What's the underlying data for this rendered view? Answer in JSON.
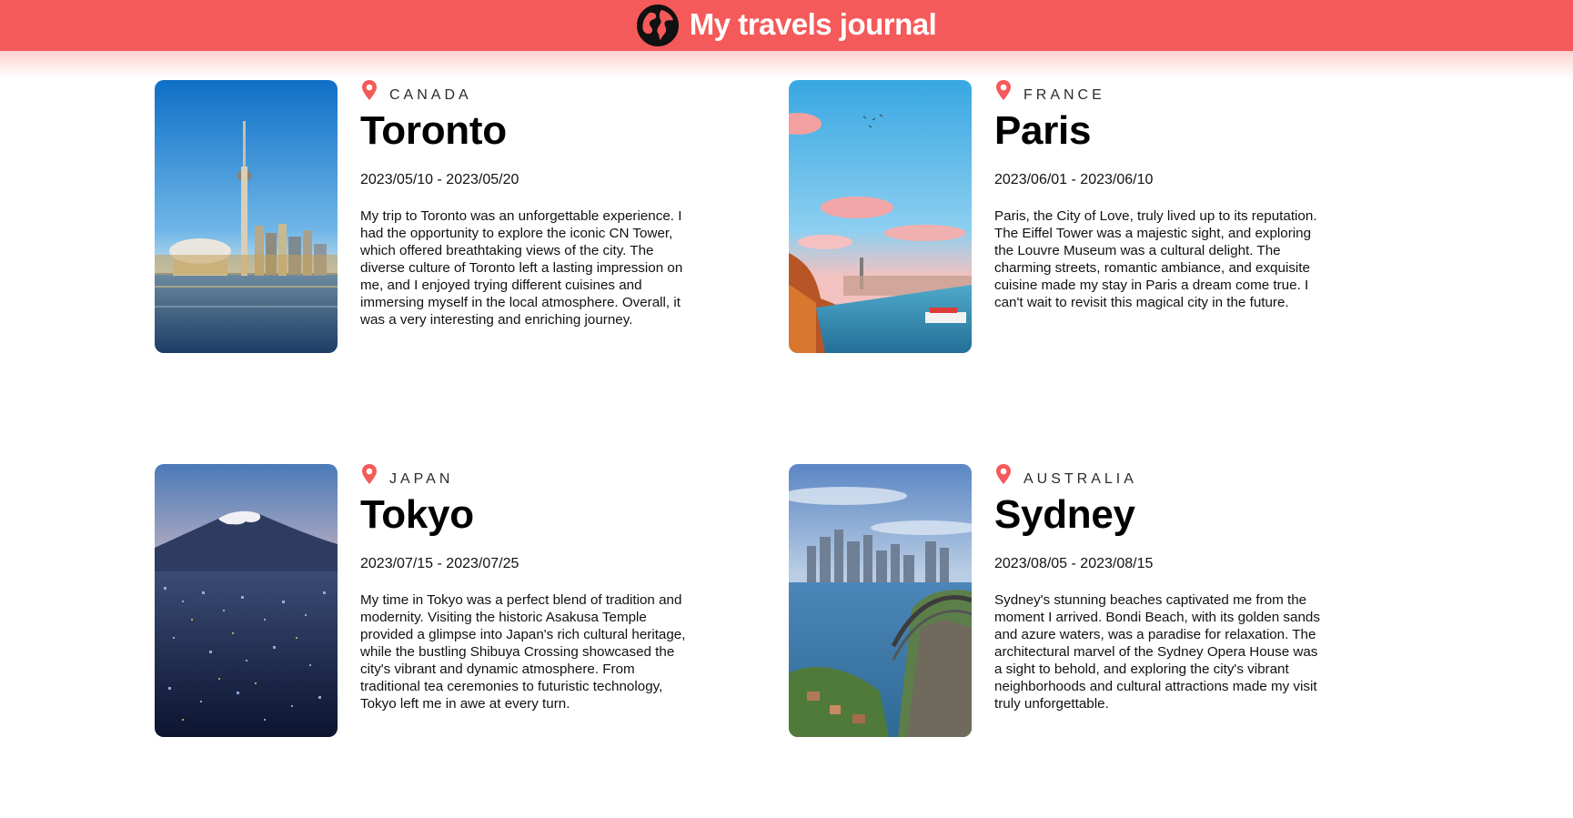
{
  "header": {
    "title": "My travels journal",
    "icon": "globe-icon",
    "background": "#f55a5a"
  },
  "entries": [
    {
      "country": "CANADA",
      "city": "Toronto",
      "dates": "2023/05/10 - 2023/05/20",
      "description": "My trip to Toronto was an unforgettable experience. I had the opportunity to explore the iconic CN Tower, which offered breathtaking views of the city. The diverse culture of Toronto left a lasting impression on me, and I enjoyed trying different cuisines and immersing myself in the local atmosphere. Overall, it was a very interesting and enriching journey.",
      "pin_icon": "map-pin-icon",
      "pin_color": "#f55a5a"
    },
    {
      "country": "FRANCE",
      "city": "Paris",
      "dates": "2023/06/01 - 2023/06/10",
      "description": "Paris, the City of Love, truly lived up to its reputation. The Eiffel Tower was a majestic sight, and exploring the Louvre Museum was a cultural delight. The charming streets, romantic ambiance, and exquisite cuisine made my stay in Paris a dream come true. I can't wait to revisit this magical city in the future.",
      "pin_icon": "map-pin-icon",
      "pin_color": "#f55a5a"
    },
    {
      "country": "JAPAN",
      "city": "Tokyo",
      "dates": "2023/07/15 - 2023/07/25",
      "description": "My time in Tokyo was a perfect blend of tradition and modernity. Visiting the historic Asakusa Temple provided a glimpse into Japan's rich cultural heritage, while the bustling Shibuya Crossing showcased the city's vibrant and dynamic atmosphere. From traditional tea ceremonies to futuristic technology, Tokyo left me in awe at every turn.",
      "pin_icon": "map-pin-icon",
      "pin_color": "#f55a5a"
    },
    {
      "country": "AUSTRALIA",
      "city": "Sydney",
      "dates": "2023/08/05 - 2023/08/15",
      "description": "Sydney's stunning beaches captivated me from the moment I arrived. Bondi Beach, with its golden sands and azure waters, was a paradise for relaxation. The architectural marvel of the Sydney Opera House was a sight to behold, and exploring the city's vibrant neighborhoods and cultural attractions made my visit truly unforgettable.",
      "pin_icon": "map-pin-icon",
      "pin_color": "#f55a5a"
    }
  ]
}
